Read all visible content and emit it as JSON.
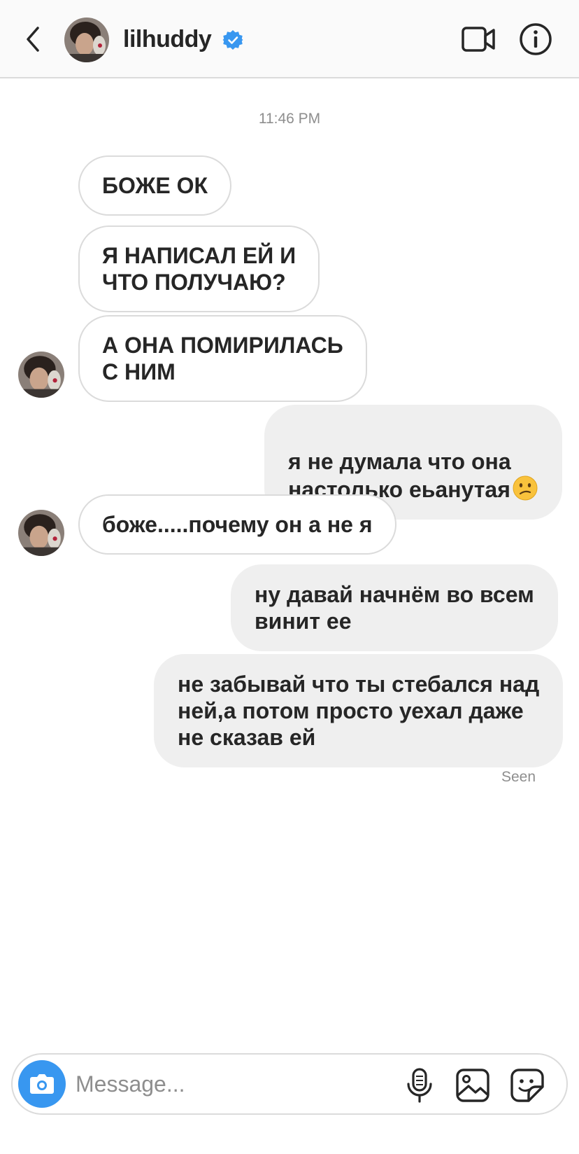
{
  "header": {
    "username": "lilhuddy",
    "verified": true,
    "icons": [
      "back-chevron-icon",
      "video-call-icon",
      "info-icon",
      "verified-badge-icon"
    ]
  },
  "thread": {
    "timestamp": "11:46 PM",
    "messages": [
      {
        "direction": "incoming",
        "text": "БОЖЕ ОК"
      },
      {
        "direction": "incoming",
        "text": "Я НАПИСАЛ ЕЙ И\nЧТО ПОЛУЧАЮ?"
      },
      {
        "direction": "incoming",
        "text": "А ОНА ПОМИРИЛАСЬ\nС НИМ"
      },
      {
        "direction": "outgoing",
        "text": "я не думала что она\nнастолько еьанутая",
        "emoji": "confused-face"
      },
      {
        "direction": "incoming",
        "text": "боже.....почему он а не я"
      },
      {
        "direction": "outgoing",
        "text": "ну давай начнём во всем\nвинит ее"
      },
      {
        "direction": "outgoing",
        "text": "не забывай что ты стебался над\nней,а потом просто уехал даже\nне сказав ей"
      }
    ],
    "status": "Seen"
  },
  "composer": {
    "placeholder": "Message...",
    "value": "",
    "icons": [
      "camera-icon",
      "microphone-icon",
      "gallery-icon",
      "sticker-icon"
    ]
  },
  "colors": {
    "accent": "#3897f0",
    "verified": "#3897f0",
    "outgoing_bubble": "#efefef",
    "incoming_border": "#dbdbdb",
    "secondary_text": "#8e8e8e"
  }
}
